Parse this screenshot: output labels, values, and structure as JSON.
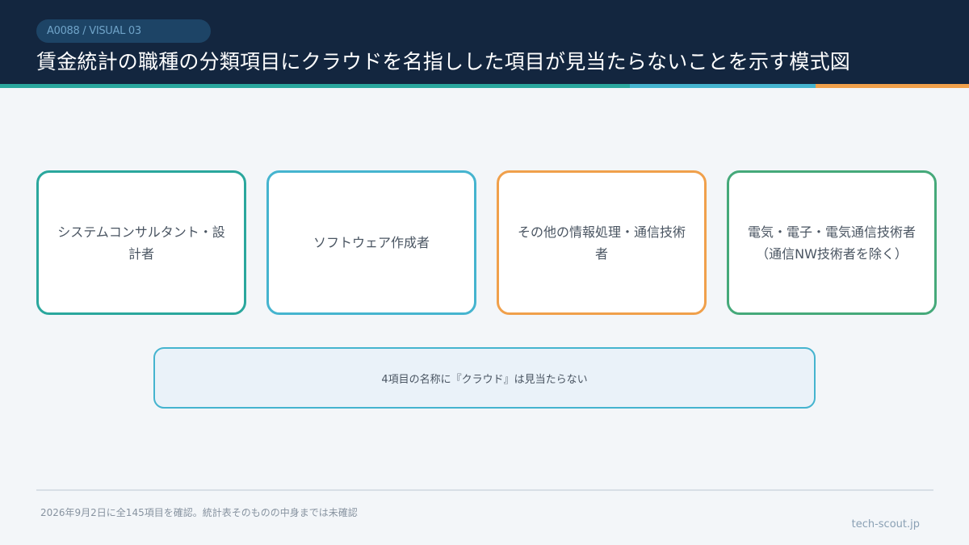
{
  "header": {
    "tag": "A0088 / VISUAL 03",
    "title": "賃金統計の職種の分類項目にクラウドを名指しした項目が見当たらないことを示す模式図"
  },
  "colors": {
    "header_bg": "#13263f",
    "teal": "#2aa79d",
    "cyan": "#45b4cf",
    "orange": "#f0a04b",
    "green": "#45a97a"
  },
  "categories": [
    {
      "label": "システムコンサルタント・設計者",
      "sub": ""
    },
    {
      "label": "ソフトウェア作成者",
      "sub": ""
    },
    {
      "label": "その他の情報処理・通信技術者",
      "sub": ""
    },
    {
      "label": "電気・電子・電気通信技術者",
      "sub": "（通信NW技術者を除く）"
    }
  ],
  "note": "4項目の名称に『クラウド』は見当たらない",
  "footer": {
    "footnote": "2026年9月2日に全145項目を確認。統計表そのものの中身までは未確認",
    "site": "tech-scout.jp"
  }
}
